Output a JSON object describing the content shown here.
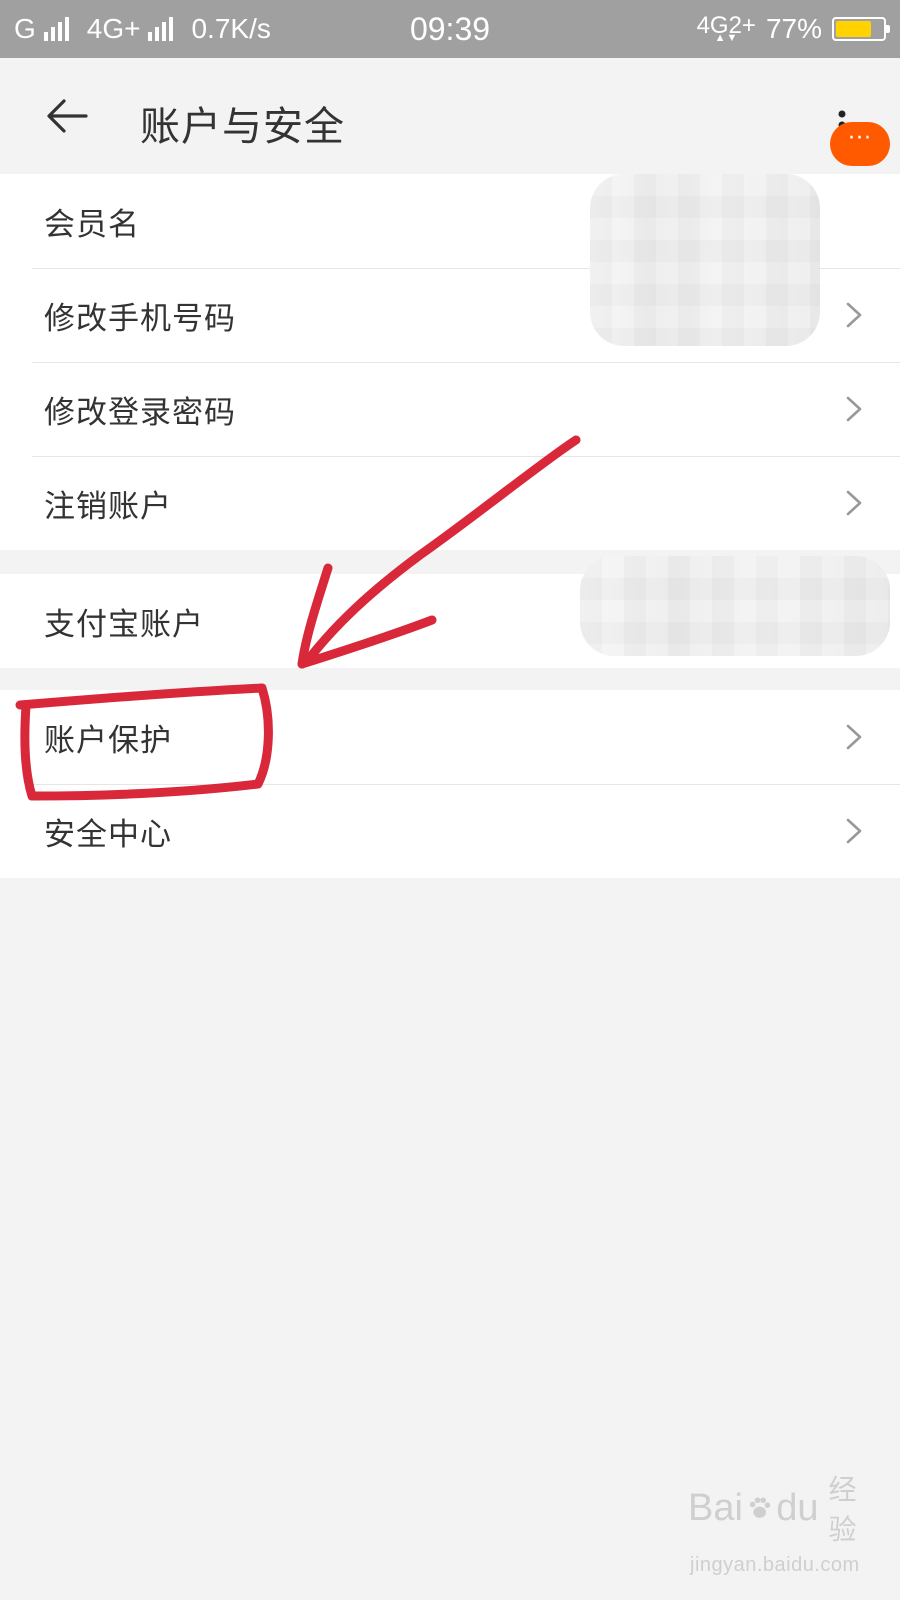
{
  "status_bar": {
    "signal1": "G",
    "signal2": "4G+",
    "speed": "0.7K/s",
    "time": "09:39",
    "network": "4G2+",
    "battery": "77%",
    "battery_level": 0.77,
    "battery_color": "#ffd200"
  },
  "header": {
    "back_icon": "arrow-left-icon",
    "title": "账户与安全",
    "more_icon": "more-vertical-icon",
    "badge_text": "···",
    "badge_color": "#ff5a00"
  },
  "groups": [
    {
      "items": [
        {
          "label": "会员名",
          "value": "0",
          "has_chevron": false
        },
        {
          "label": "修改手机号码",
          "has_chevron": true
        },
        {
          "label": "修改登录密码",
          "has_chevron": true
        },
        {
          "label": "注销账户",
          "has_chevron": true
        }
      ]
    },
    {
      "items": [
        {
          "label": "支付宝账户",
          "has_chevron": true
        }
      ]
    },
    {
      "items": [
        {
          "label": "账户保护",
          "has_chevron": true,
          "highlighted": true
        },
        {
          "label": "安全中心",
          "has_chevron": true
        }
      ]
    }
  ],
  "annotation": {
    "color": "#d8283a",
    "arrow": "hand-drawn arrow pointing to highlighted item",
    "box": "hand-drawn box around 账户保护"
  },
  "watermark": {
    "brand_left": "Bai",
    "brand_right": "du",
    "brand_cn": "经验",
    "url": "jingyan.baidu.com"
  }
}
